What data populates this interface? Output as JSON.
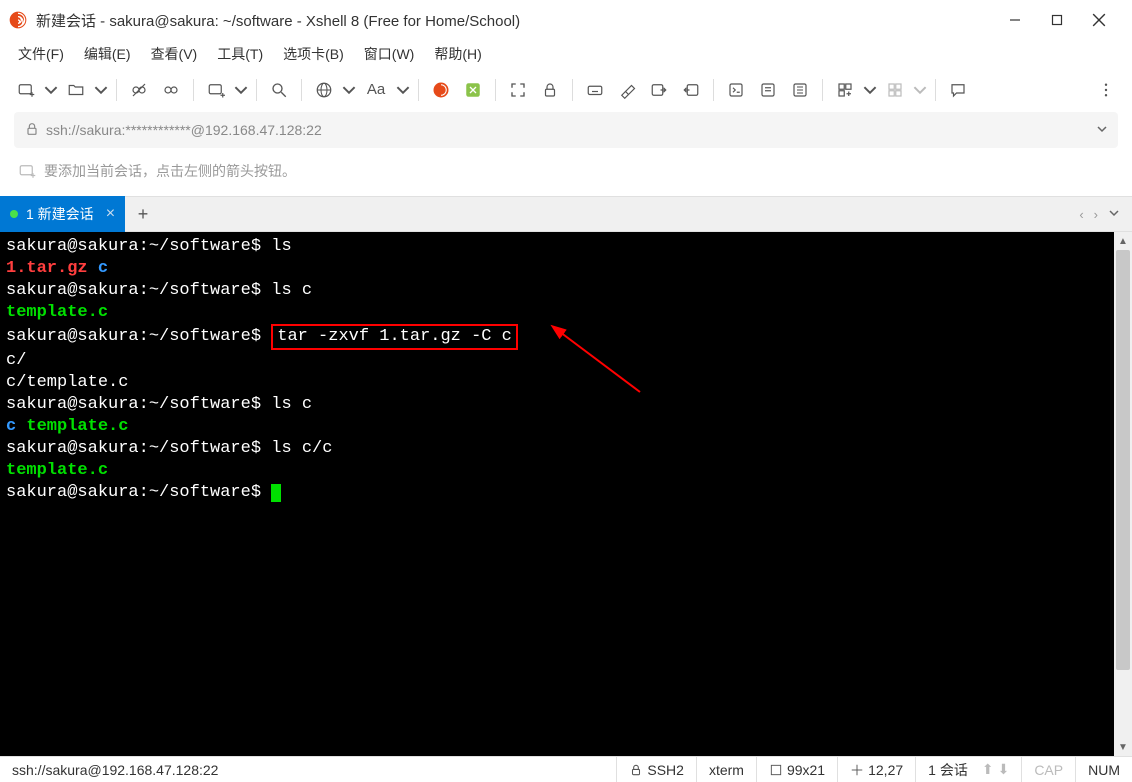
{
  "window": {
    "title": "新建会话 - sakura@sakura: ~/software - Xshell 8 (Free for Home/School)"
  },
  "menu": {
    "file": "文件(F)",
    "edit": "编辑(E)",
    "view": "查看(V)",
    "tools": "工具(T)",
    "tabs": "选项卡(B)",
    "window": "窗口(W)",
    "help": "帮助(H)"
  },
  "address": {
    "text": "ssh://sakura:************@192.168.47.128:22"
  },
  "hint": {
    "text": "要添加当前会话，点击左侧的箭头按钮。"
  },
  "tab": {
    "label": "1 新建会话"
  },
  "terminal": {
    "lines": [
      {
        "prompt": "sakura@sakura:~/software$",
        "cmd": " ls"
      },
      {
        "red": "1.tar.gz",
        "blue": "  c"
      },
      {
        "prompt": "sakura@sakura:~/software$",
        "cmd": " ls c"
      },
      {
        "green": "template.c"
      },
      {
        "prompt": "sakura@sakura:~/software$",
        "hlcmd": "tar -zxvf 1.tar.gz -C c"
      },
      {
        "plain": "c/"
      },
      {
        "plain": "c/template.c"
      },
      {
        "prompt": "sakura@sakura:~/software$",
        "cmd": " ls c"
      },
      {
        "blue": "c",
        "green": "  template.c"
      },
      {
        "prompt": "sakura@sakura:~/software$",
        "cmd": " ls c/c"
      },
      {
        "green": "template.c"
      },
      {
        "prompt": "sakura@sakura:~/software$",
        "cursor": true
      }
    ]
  },
  "status": {
    "conn": "ssh://sakura@192.168.47.128:22",
    "proto": "SSH2",
    "term": "xterm",
    "size": "99x21",
    "pos": "12,27",
    "sessions": "1 会话",
    "cap": "CAP",
    "num": "NUM"
  }
}
